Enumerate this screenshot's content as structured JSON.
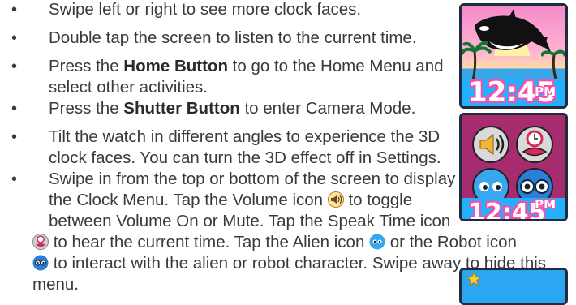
{
  "bullet_char": "•",
  "items": [
    {
      "text": "Swipe left or right to see more clock faces."
    },
    {
      "text": "Double tap the screen to listen to the current time."
    },
    {
      "pre": "Press the ",
      "bold": "Home Button",
      "line1_rest": " to go to the Home Menu and",
      "line2": "select other activities."
    },
    {
      "pre": "Press the ",
      "bold": "Shutter Button",
      "rest": " to enter Camera Mode."
    },
    {
      "line1": "Tilt the watch in different angles to experience the 3D",
      "line2": "clock faces. You can turn the 3D effect off in Settings."
    },
    {
      "line1": "Swipe in from the top or bottom of the screen to display",
      "line2": "the Clock Menu. Tap the Volume icon",
      "line2_end": "to toggle",
      "line3": "between Volume On or Mute. Tap the Speak Time icon",
      "line4a": "to hear the current time. Tap the Alien icon",
      "line4b": "or the Robot icon",
      "line5": "to interact with the alien or robot character. Swipe away to hide this",
      "line6": "menu."
    }
  ],
  "thumbnails": {
    "time": "12:45",
    "ampm": "PM",
    "colors": {
      "bar": "#22b1ff",
      "outline": "#ff4aa6",
      "sky_top": "#f58aca",
      "sea": "#3aa5e8"
    },
    "icons": [
      "orca-icon",
      "palm-tree-icon",
      "volume-icon",
      "speak-time-icon",
      "alien-icon",
      "robot-icon",
      "star-icon"
    ]
  }
}
